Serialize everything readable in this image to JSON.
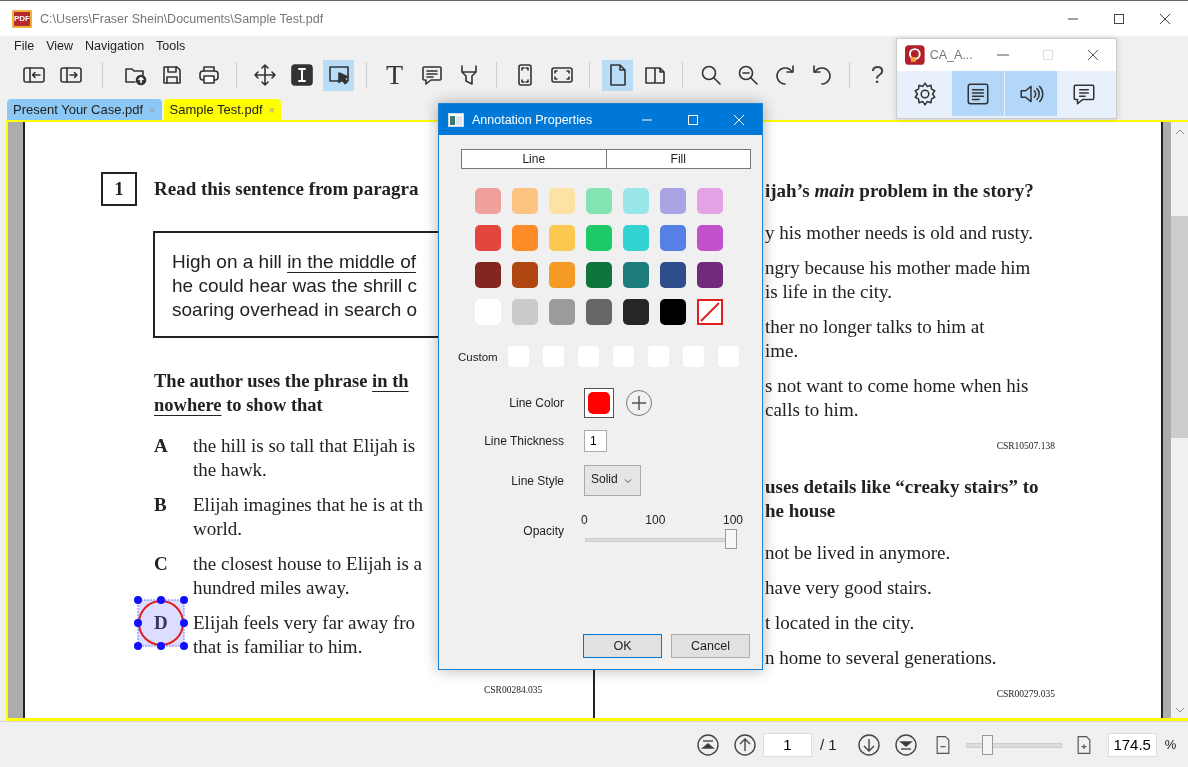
{
  "window": {
    "app_icon": "PDF",
    "title": "C:\\Users\\Fraser Shein\\Documents\\Sample Test.pdf"
  },
  "menu": [
    "File",
    "View",
    "Navigation",
    "Tools"
  ],
  "toolbar_groups": [
    {
      "items": [
        {
          "kind": "panel-left",
          "selected": false
        },
        {
          "kind": "panel-right",
          "selected": false
        }
      ]
    },
    {
      "items": [
        {
          "kind": "open",
          "selected": false
        },
        {
          "kind": "save",
          "selected": false
        },
        {
          "kind": "print",
          "selected": false
        }
      ]
    },
    {
      "items": [
        {
          "kind": "move",
          "selected": false
        },
        {
          "kind": "text-select",
          "selected": false
        },
        {
          "kind": "area-select",
          "selected": true
        }
      ]
    },
    {
      "items": [
        {
          "kind": "text",
          "label": "T",
          "selected": false
        },
        {
          "kind": "comment",
          "selected": false
        },
        {
          "kind": "highlight",
          "selected": false
        }
      ]
    },
    {
      "items": [
        {
          "kind": "fit-page",
          "selected": false
        },
        {
          "kind": "fit-width",
          "selected": false
        }
      ]
    },
    {
      "items": [
        {
          "kind": "single-page",
          "selected": true
        },
        {
          "kind": "two-page",
          "selected": false
        }
      ]
    },
    {
      "items": [
        {
          "kind": "search",
          "selected": false
        },
        {
          "kind": "zoom-out",
          "selected": false
        },
        {
          "kind": "rotate-cw",
          "selected": false
        },
        {
          "kind": "rotate-ccw",
          "selected": false
        }
      ]
    },
    {
      "items": [
        {
          "kind": "help",
          "label": "?",
          "selected": false
        }
      ]
    }
  ],
  "tabs": [
    {
      "label": "Present Your Case.pdf",
      "close": "×",
      "selected": false
    },
    {
      "label": "Sample Test.pdf",
      "close": "×",
      "selected": true
    }
  ],
  "document": {
    "left_page": {
      "blocks": [
        {
          "kind": "question",
          "number": "1",
          "text": "Read this sentence from paragra"
        },
        {
          "kind": "quote",
          "lines": [
            [
              {
                "text": "High on a hill ",
                "underlined": false
              },
              {
                "text": "in the middle of",
                "underlined": true
              }
            ],
            [
              {
                "text": "he could hear was the shrill c",
                "underlined": false
              }
            ],
            [
              {
                "text": "soaring overhead in search o",
                "underlined": false
              }
            ]
          ]
        },
        {
          "kind": "stem",
          "lines": [
            [
              {
                "text": "The author uses the phrase ",
                "underlined": false
              },
              {
                "text": "in th",
                "underlined": true
              }
            ],
            [
              {
                "text": "nowhere",
                "underlined": true
              },
              {
                "text": " to show that",
                "underlined": false
              }
            ]
          ]
        },
        {
          "kind": "option",
          "letter": "A",
          "lines": [
            "the hill is so tall that Elijah is",
            "the hawk."
          ],
          "annotated": false
        },
        {
          "kind": "option",
          "letter": "B",
          "lines": [
            "Elijah imagines that he is at th",
            "world."
          ],
          "annotated": false
        },
        {
          "kind": "option",
          "letter": "C",
          "lines": [
            "the closest house to Elijah is a",
            "hundred miles away."
          ],
          "annotated": false
        },
        {
          "kind": "option",
          "letter": "D",
          "lines": [
            "Elijah feels very far away fro",
            "that is familiar to him."
          ],
          "annotated": true
        },
        {
          "kind": "code",
          "text": "CSR00284.035"
        }
      ]
    },
    "right_page": {
      "blocks": [
        {
          "kind": "question",
          "lines": [
            "ijah’s *main* problem in the story?"
          ]
        },
        {
          "kind": "option",
          "lines": [
            "y his mother needs is old and rusty."
          ]
        },
        {
          "kind": "option",
          "lines": [
            "ngry because his mother made him",
            "is life in the city."
          ]
        },
        {
          "kind": "option",
          "lines": [
            "ther no longer talks to him at",
            "ime."
          ]
        },
        {
          "kind": "option",
          "lines": [
            "s not want to come home when his",
            "calls to him."
          ]
        },
        {
          "kind": "code",
          "text": "CSR10507.138"
        },
        {
          "kind": "question",
          "lines": [
            "uses details like “creaky stairs” to",
            "he house"
          ]
        },
        {
          "kind": "option",
          "lines": [
            "not be lived in anymore."
          ]
        },
        {
          "kind": "option",
          "lines": [
            "have very good stairs."
          ]
        },
        {
          "kind": "option",
          "lines": [
            "t located in the city."
          ]
        },
        {
          "kind": "option",
          "lines": [
            "n home to several generations."
          ]
        },
        {
          "kind": "code",
          "text": "CSR00279.035"
        }
      ]
    }
  },
  "annotation_dialog": {
    "title": "Annotation Properties",
    "tabs": [
      "Line",
      "Fill"
    ],
    "swatches": [
      [
        {
          "kind": "color",
          "color": "#f0a09c"
        },
        {
          "kind": "color",
          "color": "#fdc380"
        },
        {
          "kind": "color",
          "color": "#fde3a3"
        },
        {
          "kind": "color",
          "color": "#84e3b3"
        },
        {
          "kind": "color",
          "color": "#99e6e8"
        },
        {
          "kind": "color",
          "color": "#a8a4e4"
        },
        {
          "kind": "color",
          "color": "#e2a2e4"
        }
      ],
      [
        {
          "kind": "color",
          "color": "#e3463d"
        },
        {
          "kind": "color",
          "color": "#fd8c28"
        },
        {
          "kind": "color",
          "color": "#fdc84f"
        },
        {
          "kind": "color",
          "color": "#1ec967"
        },
        {
          "kind": "color",
          "color": "#33d2d3"
        },
        {
          "kind": "color",
          "color": "#5680e6"
        },
        {
          "kind": "color",
          "color": "#c451cc"
        }
      ],
      [
        {
          "kind": "color",
          "color": "#85251f"
        },
        {
          "kind": "color",
          "color": "#b04713"
        },
        {
          "kind": "color",
          "color": "#f39b25"
        },
        {
          "kind": "color",
          "color": "#0e753c"
        },
        {
          "kind": "color",
          "color": "#1d7c7c"
        },
        {
          "kind": "color",
          "color": "#2e4d8b"
        },
        {
          "kind": "color",
          "color": "#722a7c"
        }
      ],
      [
        {
          "kind": "color",
          "color": "#ffffff"
        },
        {
          "kind": "color",
          "color": "#cbcbcb"
        },
        {
          "kind": "color",
          "color": "#9b9b9b"
        },
        {
          "kind": "color",
          "color": "#676767"
        },
        {
          "kind": "color",
          "color": "#262626"
        },
        {
          "kind": "color",
          "color": "#000000"
        },
        {
          "kind": "none"
        }
      ]
    ],
    "custom_label": "Custom",
    "custom_swatches": [
      {
        "kind": "empty"
      },
      {
        "kind": "empty"
      },
      {
        "kind": "empty"
      },
      {
        "kind": "empty"
      },
      {
        "kind": "empty"
      },
      {
        "kind": "empty"
      },
      {
        "kind": "empty"
      }
    ],
    "line_color": {
      "label": "Line Color",
      "color": "#ff0000"
    },
    "line_thickness": {
      "label": "Line Thickness",
      "value": "1"
    },
    "line_style": {
      "label": "Line Style",
      "value": "Solid"
    },
    "opacity": {
      "label": "Opacity",
      "ticks": [
        "0",
        "100",
        "100"
      ],
      "level": 1
    },
    "buttons": [
      {
        "label": "OK",
        "default": true
      },
      {
        "label": "Cancel",
        "default": false
      }
    ]
  },
  "mini_window": {
    "title": "CA_A...",
    "maximize_enabled": false,
    "buttons": [
      {
        "kind": "settings",
        "selected": false
      },
      {
        "kind": "document",
        "selected": true
      },
      {
        "kind": "speaker",
        "selected": true
      },
      {
        "kind": "chat",
        "selected": false
      }
    ]
  },
  "status_bar": {
    "page": "1",
    "total": "/ 1",
    "zoom_slider": {
      "level": 0.2
    },
    "zoom": "174.5",
    "unit": "%"
  }
}
